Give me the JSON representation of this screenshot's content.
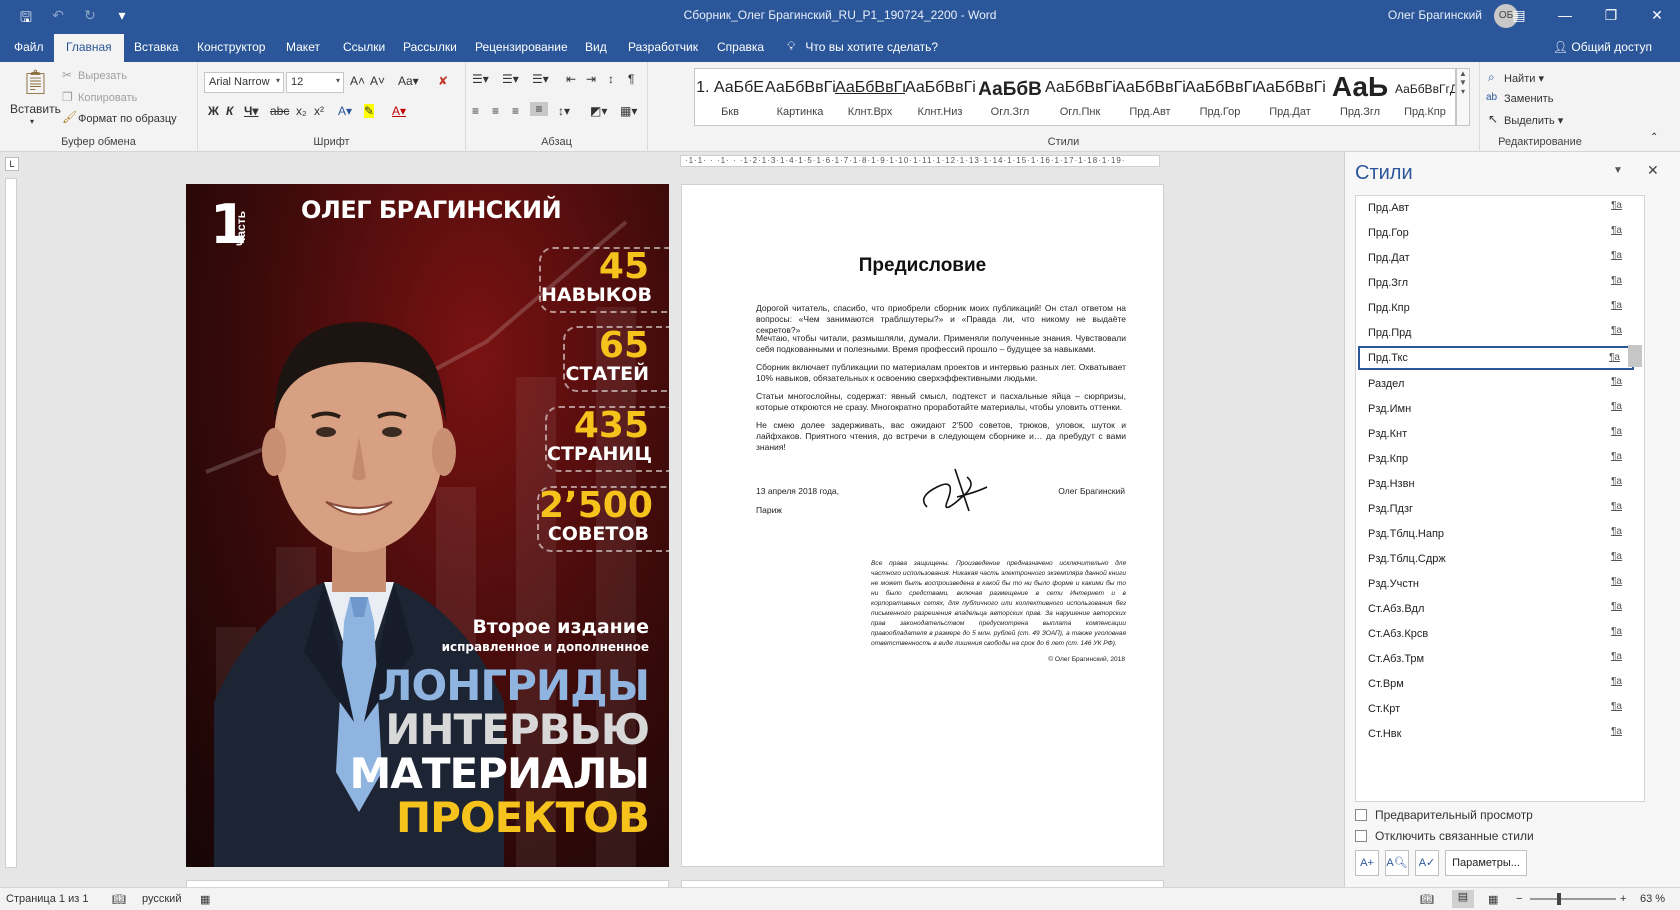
{
  "window": {
    "title": "Сборник_Олег Брагинский_RU_P1_190724_2200  -  Word",
    "user": "Олег Брагинский",
    "avatar": "ОБ"
  },
  "tabs": [
    "Файл",
    "Главная",
    "Вставка",
    "Конструктор",
    "Макет",
    "Ссылки",
    "Рассылки",
    "Рецензирование",
    "Вид",
    "Разработчик",
    "Справка"
  ],
  "active_tab": "Главная",
  "tell_me": "Что вы хотите сделать?",
  "share": "Общий доступ",
  "ribbon": {
    "clipboard": {
      "paste": "Вставить",
      "cut": "Вырезать",
      "copy": "Копировать",
      "format_painter": "Формат по образцу",
      "label": "Буфер обмена"
    },
    "font": {
      "name": "Arial Narrow",
      "size": "12",
      "label": "Шрифт"
    },
    "paragraph": {
      "label": "Абзац"
    },
    "styles": {
      "label": "Стили",
      "items": [
        {
          "sample": "1. АаБбЕ",
          "name": "Бкв"
        },
        {
          "sample": "АаБбВвГі",
          "name": "Картинка"
        },
        {
          "sample": "АаБбВвГг",
          "name": "Клнт.Врх"
        },
        {
          "sample": "АаБбВвГі",
          "name": "Клнт.Низ"
        },
        {
          "sample": "АаБбВ",
          "name": "Огл.Згл"
        },
        {
          "sample": "АаБбВвГі",
          "name": "Огл.Пнк"
        },
        {
          "sample": "АаБбВвГі",
          "name": "Прд.Авт"
        },
        {
          "sample": "АаБбВвГг",
          "name": "Прд.Гор"
        },
        {
          "sample": "АаБбВвГі",
          "name": "Прд.Дат"
        },
        {
          "sample": "АаЬ",
          "name": "Прд.Згл"
        },
        {
          "sample": "АаБбВвГгД",
          "name": "Прд.Кпр"
        }
      ]
    },
    "editing": {
      "find": "Найти",
      "replace": "Заменить",
      "select": "Выделить",
      "label": "Редактирование"
    }
  },
  "cover": {
    "part_number": "1",
    "part_label": "Часть",
    "author": "ОЛЕГ БРАГИНСКИЙ",
    "stats": [
      {
        "num": "45",
        "label": "НАВЫКОВ"
      },
      {
        "num": "65",
        "label": "СТАТЕЙ"
      },
      {
        "num": "435",
        "label": "СТРАНИЦ"
      },
      {
        "num": "2’500",
        "label": "СОВЕТОВ"
      }
    ],
    "edition": "Второе издание",
    "edition_sub": "исправленное и дополненное",
    "title_lines": [
      "ЛОНГРИДЫ",
      "ИНТЕРВЬЮ",
      "МАТЕРИАЛЫ",
      "ПРОЕКТОВ"
    ]
  },
  "page2": {
    "title": "Предисловие",
    "paragraphs": [
      "Дорогой читатель, спасибо, что приобрели сборник моих публикаций! Он стал ответом на вопросы: «Чем занимаются траблшутеры?» и «Правда ли, что никому не выдаёте секретов?»",
      "Мечтаю, чтобы читали, размышляли, думали. Применяли полученные знания. Чувствовали себя подкованными и полезными. Время профессий прошло – будущее за навыками.",
      "Сборник включает публикации по материалам проектов и интервью разных лет. Охватывает 10% навыков, обязательных к освоению сверхэффективными людьми.",
      "Статьи многослойны, содержат: явный смысл, подтекст и пасхальные яйца – сюрпризы, которые откроются не сразу. Многократно проработайте материалы, чтобы уловить оттенки.",
      "Не смею долее задерживать, вас ожидают 2’500 советов, трюков, уловок, шуток и лайфхаков. Приятного чтения, до встречи в следующем сборнике и… да пребудут с вами знания!"
    ],
    "date": "13 апреля 2018 года,",
    "place": "Париж",
    "signature_name": "Олег Брагинский",
    "rights": "Все права защищены. Произведение предназначено исключительно для частного использования. Никакая часть электронного экземпляра данной книги не может быть воспроизведена в какой бы то ни было форме и какими бы то ни было средствами, включая размещение в сети Интернет и в корпоративных сетях, для публичного или коллективного использования без письменного разрешения владельца авторских прав. За нарушение авторских прав законодательством предусмотрена выплата компенсации правообладателя в размере до 5 млн. рублей (ст. 49 ЗОАП), а также уголовная ответственность в виде лишения свободы на срок до 6 лет (ст. 146 УК РФ).",
    "copyright": "© Олег Брагинский, 2018"
  },
  "ruler": "·1·1· · ·1· · ·1·2·1·3·1·4·1·5·1·6·1·7·1·8·1·9·1·10·1·11·1·12·1·13·1·14·1·15·1·16·1·17·1·18·1·19·",
  "styles_pane": {
    "title": "Стили",
    "items": [
      "Прд.Авт",
      "Прд.Гор",
      "Прд.Дат",
      "Прд.Згл",
      "Прд.Кпр",
      "Прд.Прд",
      "Прд.Ткс",
      "Раздел",
      "Рзд.Имн",
      "Рзд.Кнт",
      "Рзд.Кпр",
      "Рзд.Нзвн",
      "Рзд.Пдзг",
      "Рзд.Тблц.Напр",
      "Рзд.Тблц.Сдрж",
      "Рзд.Учстн",
      "Ст.Абз.Вдл",
      "Ст.Абз.Крсв",
      "Ст.Абз.Трм",
      "Ст.Врм",
      "Ст.Крт",
      "Ст.Нвк"
    ],
    "selected": "Прд.Ткс",
    "link_mark": "¶a",
    "preview": "Предварительный просмотр",
    "disable_linked": "Отключить связанные стили",
    "options": "Параметры..."
  },
  "status": {
    "page": "Страница 1 из 1",
    "language": "русский",
    "zoom": "63 %",
    "zoom_level": 0.63
  },
  "colors": {
    "accent": "#2b579a",
    "cover_yellow": "#f6c21c",
    "cover_blue": "#8fb4e0"
  }
}
